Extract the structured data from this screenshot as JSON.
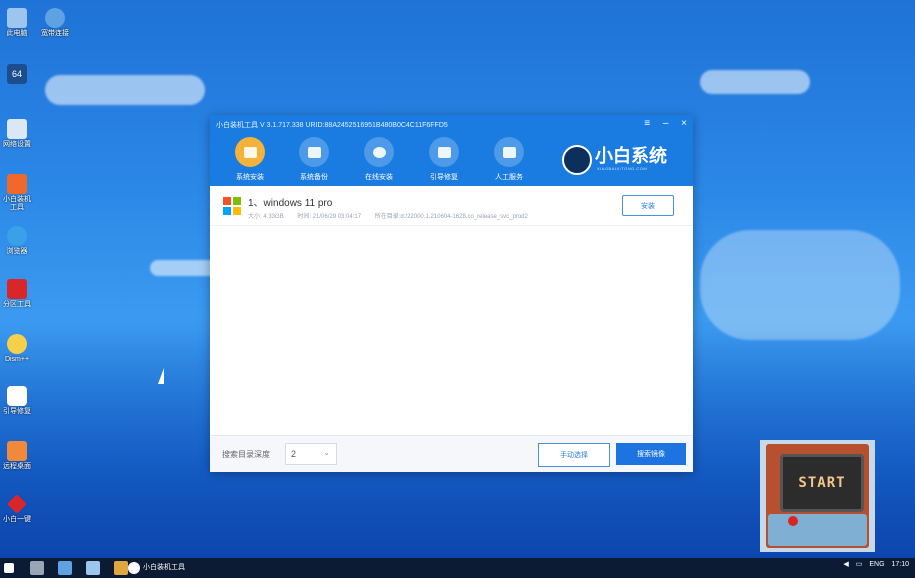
{
  "window": {
    "title": "小白装机工具 V 3.1.717.338 URID:88A2452516951B480B0C4C11F6FFD5",
    "controls": [
      "≡",
      "–",
      "×"
    ],
    "tabs": [
      {
        "label": "系统安装",
        "icon": "system-install-icon"
      },
      {
        "label": "系统备份",
        "icon": "system-backup-icon"
      },
      {
        "label": "在线安装",
        "icon": "online-install-icon"
      },
      {
        "label": "引导修复",
        "icon": "boot-repair-icon"
      },
      {
        "label": "人工服务",
        "icon": "support-icon"
      }
    ],
    "brand": {
      "name": "小白系统",
      "sub": "XIAOBAIXITONG.COM"
    },
    "item": {
      "title": "1、windows 11 pro",
      "size": "大小: 4.33GB",
      "date": "时间: 21/06/29 03:04:17",
      "path": "所在目录:d:/22000.1.210604-1628.co_release_svc_prod2",
      "install_label": "安装"
    },
    "footer": {
      "depth_label": "搜索目录深度",
      "depth_value": "2",
      "manual_label": "手动选择",
      "search_label": "搜索镜像"
    }
  },
  "desktop": {
    "icons": [
      {
        "label": "此电脑"
      },
      {
        "label": "宽带连接"
      },
      {
        "label": "64"
      },
      {
        "label": "网络设置"
      },
      {
        "label": "小白装机工具"
      },
      {
        "label": "浏览器"
      },
      {
        "label": "分区工具"
      },
      {
        "label": "Dism++"
      },
      {
        "label": "引导修复"
      },
      {
        "label": "远程桌面"
      },
      {
        "label": "小白一键"
      }
    ],
    "arcade_text": "START"
  },
  "taskbar": {
    "app_label": "小白装机工具",
    "lang": "ENG",
    "time": "17:10"
  }
}
